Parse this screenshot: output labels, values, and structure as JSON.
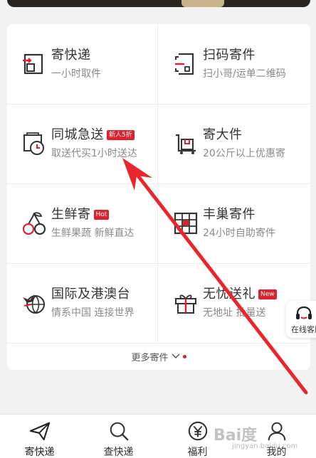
{
  "services": [
    {
      "title": "寄快递",
      "subtitle": "一小时取件",
      "badge": "",
      "icon": "express-box-icon"
    },
    {
      "title": "扫码寄件",
      "subtitle": "扫小哥/运单二维码",
      "badge": "",
      "icon": "scan-qr-icon"
    },
    {
      "title": "同城急送",
      "subtitle": "取送代买1小时送达",
      "badge": "新人5折",
      "icon": "city-clock-icon"
    },
    {
      "title": "寄大件",
      "subtitle": "20公斤以上优惠寄",
      "badge": "",
      "icon": "cart-box-icon"
    },
    {
      "title": "生鲜寄",
      "subtitle": "生鲜果蔬 新鲜直达",
      "badge": "Hot",
      "icon": "cherry-icon"
    },
    {
      "title": "丰巢寄件",
      "subtitle": "24小时自助寄件",
      "badge": "",
      "icon": "locker-icon"
    },
    {
      "title": "国际及港澳台",
      "subtitle": "情系中国 连接世界",
      "badge": "",
      "icon": "globe-plane-icon"
    },
    {
      "title": "无忧送礼",
      "subtitle": "无地址 批量送",
      "badge": "New",
      "icon": "gift-icon"
    }
  ],
  "more": {
    "label": "更多寄件"
  },
  "float_service": {
    "label": "在线客服"
  },
  "nav": [
    {
      "label": "寄快递",
      "icon": "paper-plane-icon"
    },
    {
      "label": "查快递",
      "icon": "magnifier-icon"
    },
    {
      "label": "福利",
      "icon": "yuan-coin-icon"
    },
    {
      "label": "我的",
      "icon": "person-icon"
    }
  ],
  "watermark": {
    "text": "Bai度",
    "sub": "jingyan.baidu.com"
  },
  "colors": {
    "accent": "#e0202f",
    "text": "#333333",
    "subtext": "#8a8a8a",
    "background": "#f2f2f2"
  }
}
